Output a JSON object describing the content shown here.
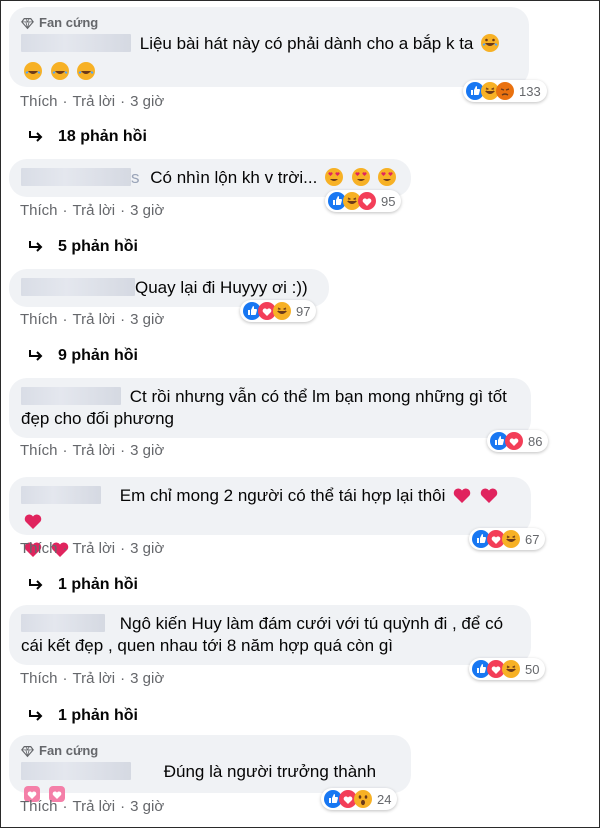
{
  "badge_label": "Fan cứng",
  "actions": {
    "like": "Thích",
    "reply": "Trả lời",
    "sep": "·"
  },
  "comments": [
    {
      "name_tail": "",
      "text": "Liệu bài hát này có phải dành cho a bắp k ta",
      "time": "3 giờ",
      "reactions": [
        "like",
        "haha",
        "angry"
      ],
      "count": "133",
      "replies": "18 phản hồi",
      "badge": true
    },
    {
      "name_tail": "s",
      "text": "Có nhìn lộn kh v trời... ",
      "time": "3 giờ",
      "reactions": [
        "like",
        "haha",
        "love"
      ],
      "count": "95",
      "replies": "5 phản hồi",
      "badge": false
    },
    {
      "name_tail": "",
      "text": "Quay lại đi Huyyy ơi :))",
      "time": "3 giờ",
      "reactions": [
        "like",
        "love",
        "haha"
      ],
      "count": "97",
      "replies": "9 phản hồi",
      "badge": false
    },
    {
      "name_tail": "",
      "text": "Ct rồi nhưng vẫn có thể lm bạn mong những gì tốt đẹp cho đối phương",
      "time": "3 giờ",
      "reactions": [
        "like",
        "love"
      ],
      "count": "86",
      "replies": "",
      "badge": false
    },
    {
      "name_tail": "",
      "text": "Em chỉ mong 2 người có thể tái hợp lại thôi",
      "time": "3 giờ",
      "reactions": [
        "like",
        "love",
        "haha"
      ],
      "count": "67",
      "replies": "1 phản hồi",
      "badge": false
    },
    {
      "name_tail": "",
      "text": "Ngô kiến Huy làm đám cưới với tú quỳnh đi , để có cái kết đẹp , quen nhau tới 8 năm hợp quá còn gì",
      "time": "3 giờ",
      "reactions": [
        "like",
        "love",
        "haha"
      ],
      "count": "50",
      "replies": "1 phản hồi",
      "badge": false
    },
    {
      "name_tail": "",
      "text": "Đúng là người trưởng thành",
      "time": "3 giờ",
      "reactions": [
        "like",
        "love",
        "wow"
      ],
      "count": "24",
      "replies": "",
      "badge": true
    }
  ],
  "colors": {
    "like": "#1877f2",
    "love": "#f33e58",
    "haha": "#f7b125",
    "angry": "#e9710f",
    "bubble": "#f0f2f5",
    "muted": "#65676b"
  }
}
